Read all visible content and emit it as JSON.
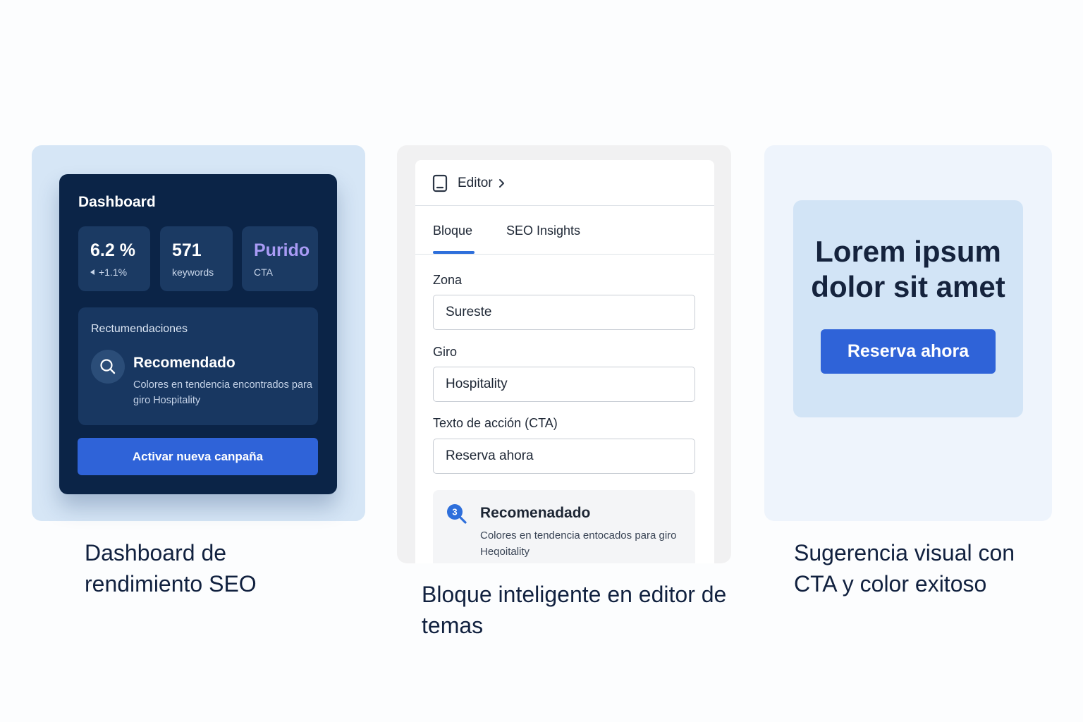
{
  "dashboard": {
    "title": "Dashboard",
    "stats": [
      {
        "value": "6.2 %",
        "sub": "+1.1%"
      },
      {
        "value": "571",
        "sub": "keywords"
      },
      {
        "value": "Purido",
        "sub": "CTA"
      }
    ],
    "recommendations": {
      "heading": "Rectumendaciones",
      "title": "Recomendado",
      "text": "Colores en tendencia encontrados para giro Hospitality"
    },
    "cta_label": "Activar nueva canpaña",
    "caption": "Dashboard de rendimiento SEO"
  },
  "editor": {
    "title": "Editor",
    "tabs": [
      {
        "label": "Bloque",
        "active": true
      },
      {
        "label": "SEO Insights",
        "active": false
      }
    ],
    "fields": [
      {
        "label": "Zona",
        "value": "Sureste"
      },
      {
        "label": "Giro",
        "value": "Hospitality"
      },
      {
        "label": "Texto de acción (CTA)",
        "value": "Reserva ahora"
      }
    ],
    "recommendation": {
      "badge": "3",
      "title": "Recomenadado",
      "text": "Colores en tendencia entocados para giro Heqoitality"
    },
    "caption": "Bloque inteligente en editor de temas"
  },
  "visual": {
    "headline": "Lorem ipsum dolor sit amet",
    "cta_label": "Reserva ahora",
    "caption": "Sugerencia visual con CTA y color exitoso"
  },
  "colors": {
    "accent_blue": "#2f63d8",
    "dashboard_bg": "#0b2447",
    "highlight_purple": "#a99bf5",
    "tab_indicator": "#2e6fdb"
  },
  "icons": [
    "trend-left-icon",
    "search-icon",
    "document-icon",
    "chevron-right-icon",
    "search-badge-icon"
  ]
}
